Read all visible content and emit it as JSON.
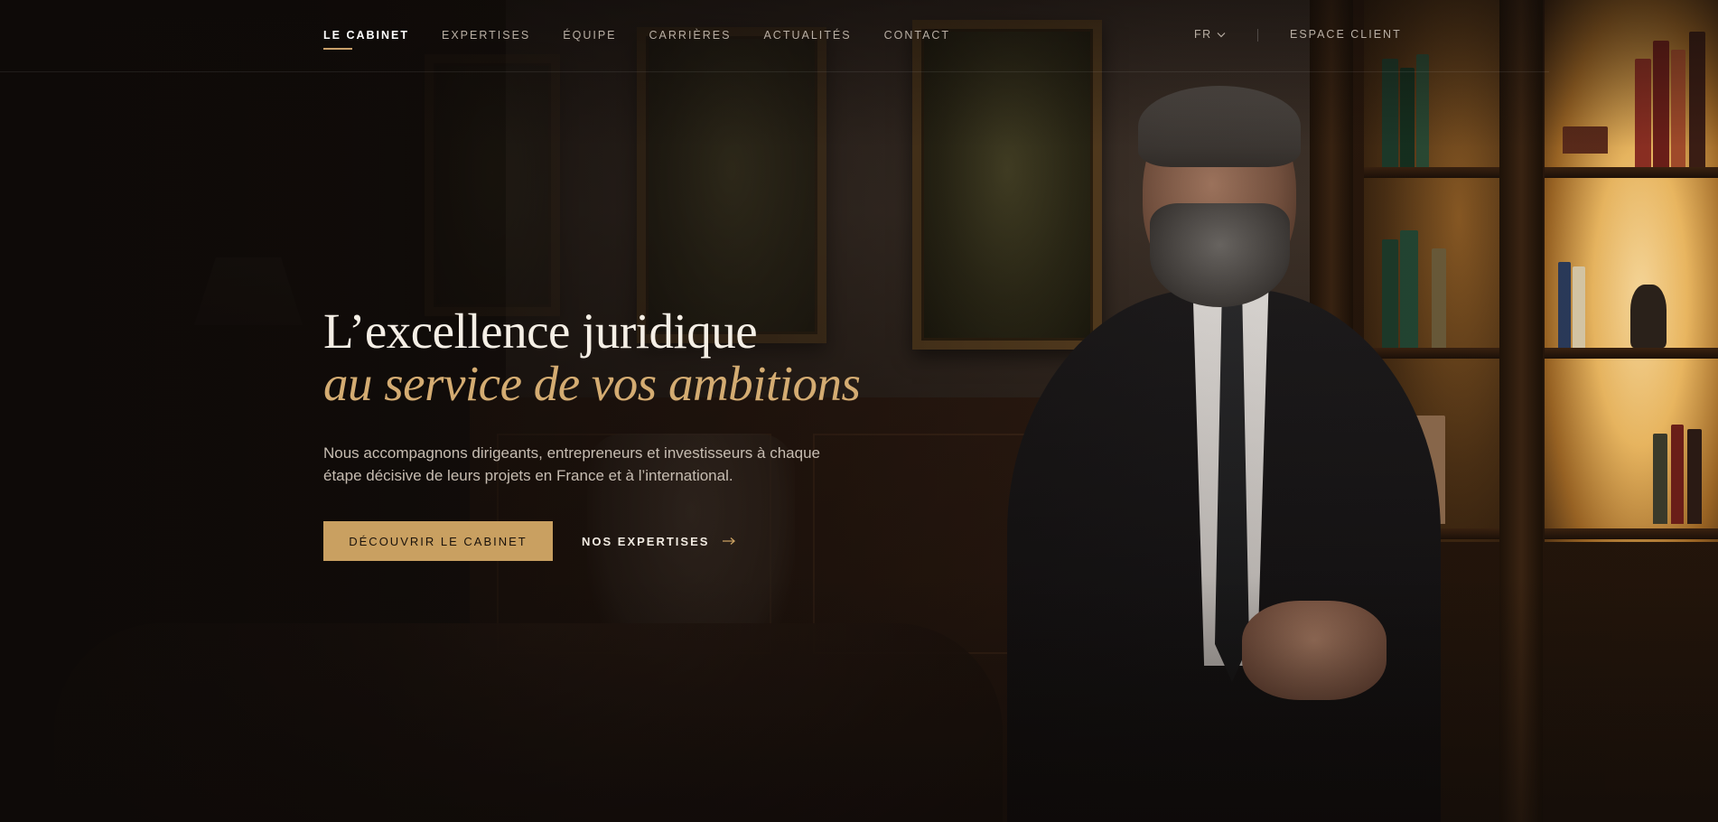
{
  "nav": {
    "items": [
      "LE CABINET",
      "EXPERTISES",
      "ÉQUIPE",
      "CARRIÈRES",
      "ACTUALITÉS",
      "CONTACT"
    ],
    "active": "LE CABINET"
  },
  "header": {
    "language": "FR",
    "client_link": "ESPACE CLIENT"
  },
  "hero": {
    "title_line1": "L’excellence juridique",
    "title_line2": "au service de vos ambitions",
    "subtitle": "Nous accompagnons dirigeants, entrepreneurs et investisseurs à chaque étape décisive de leurs projets en France et à l’international.",
    "primary_cta": "DÉCOUVRIR LE CABINET",
    "secondary_cta": "NOS EXPERTISES"
  },
  "icons": {
    "language_dropdown": "chevron-down-icon",
    "secondary_cta": "arrow-right-icon"
  },
  "colors": {
    "accent_gold": "#c9a061",
    "title_italic_gold": "#d4ac72",
    "background_dark": "#120d0a",
    "nav_text": "#b9afa4"
  }
}
